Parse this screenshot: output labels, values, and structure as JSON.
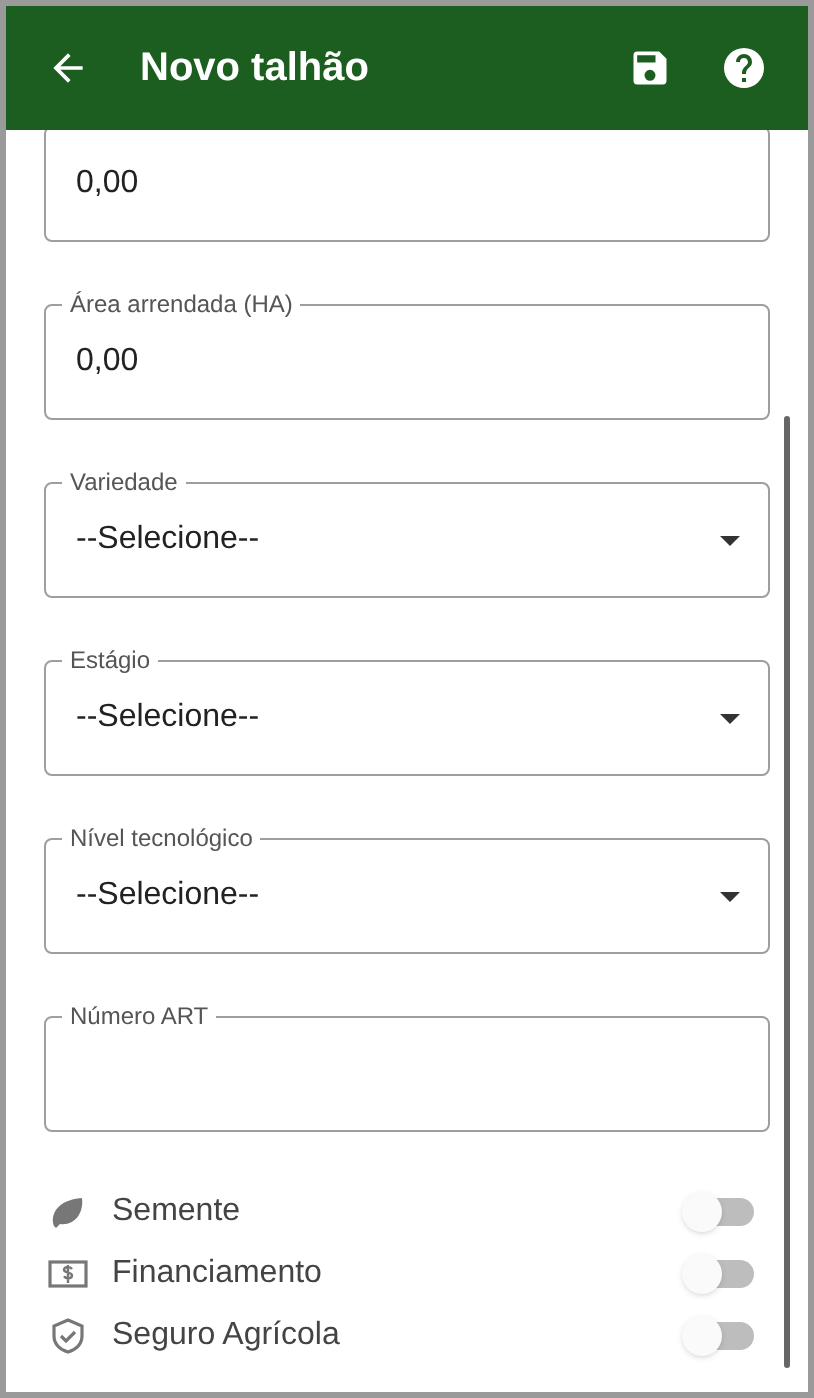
{
  "header": {
    "title": "Novo talhão"
  },
  "fields": [
    {
      "kind": "text",
      "value": "0,00"
    },
    {
      "kind": "text",
      "label": "Área arrendada (HA)",
      "value": "0,00"
    },
    {
      "kind": "select",
      "label": "Variedade",
      "value": "--Selecione--"
    },
    {
      "kind": "select",
      "label": "Estágio",
      "value": "--Selecione--"
    },
    {
      "kind": "select",
      "label": "Nível tecnológico",
      "value": "--Selecione--"
    },
    {
      "kind": "text",
      "label": "Número ART"
    }
  ],
  "switches": [
    {
      "kind": "leaf",
      "label": "Semente",
      "on": false
    },
    {
      "kind": "money",
      "label": "Financiamento",
      "on": false
    },
    {
      "kind": "shield",
      "label": "Seguro Agrícola",
      "on": false
    }
  ]
}
